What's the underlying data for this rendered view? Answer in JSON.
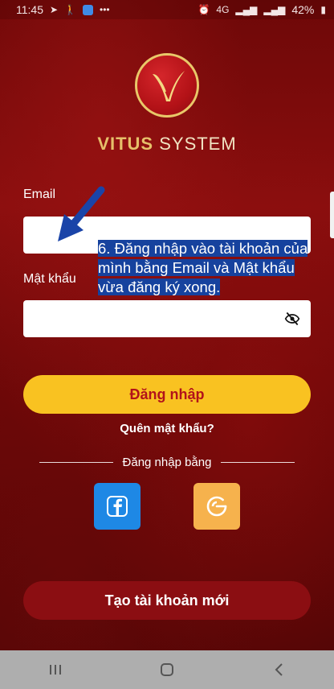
{
  "status_bar": {
    "time": "11:45",
    "network": "4G",
    "battery": "42%"
  },
  "brand": {
    "name_bold": "VITUS",
    "name_light": " SYSTEM"
  },
  "form": {
    "email_label": "Email",
    "email_value": "",
    "password_label": "Mật khẩu",
    "password_value": ""
  },
  "annotation": {
    "text": "6. Đăng nhập vào tài khoản của mình bằng Email và Mật khẩu vừa đăng ký xong."
  },
  "actions": {
    "login_label": "Đăng nhập",
    "forgot_label": "Quên mật khẩu?",
    "divider_label": "Đăng nhập bằng",
    "create_account_label": "Tạo tài khoản mới"
  },
  "social": [
    {
      "icon": "facebook-icon"
    },
    {
      "icon": "google-icon"
    }
  ],
  "colors": {
    "accent_yellow": "#f9c221",
    "login_text": "#b2121a",
    "create_button": "#8b0e12",
    "facebook_blue": "#1e88e5",
    "google_tile": "#f6b24d",
    "annotation_bg": "#16429e"
  },
  "nav": {
    "recent": "recent-apps-icon",
    "home": "home-icon",
    "back": "back-icon"
  }
}
